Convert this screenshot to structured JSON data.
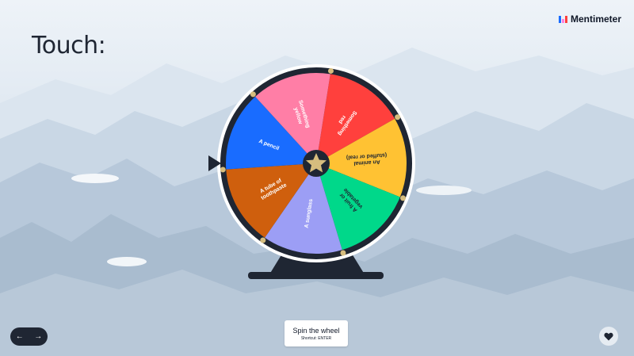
{
  "slide": {
    "title": "Touch:"
  },
  "brand": {
    "name": "Mentimeter",
    "logo_colors": [
      "#196cff",
      "#ff80e3",
      "#ff403d"
    ]
  },
  "wheel": {
    "center_icon": "star-icon",
    "pointer_icon": "triangle-pointer-icon",
    "segments": [
      {
        "label_lines": [
          "Something",
          "red"
        ],
        "color": "#ff403d"
      },
      {
        "label_lines": [
          "An animal",
          "(stuffed or real)"
        ],
        "color": "#ffc233"
      },
      {
        "label_lines": [
          "A fruit or",
          "vegetable"
        ],
        "color": "#00d88a"
      },
      {
        "label_lines": [
          "A sunglass"
        ],
        "color": "#9c9ef5"
      },
      {
        "label_lines": [
          "A tube of",
          "toothpaste"
        ],
        "color": "#cf5f0d"
      },
      {
        "label_lines": [
          "A pencil"
        ],
        "color": "#196cff"
      },
      {
        "label_lines": [
          "Something",
          "yellow"
        ],
        "color": "#ff7ea6"
      }
    ]
  },
  "spin": {
    "label": "Spin the wheel",
    "shortcut": "Shortcut: ENTER"
  },
  "nav": {
    "prev_icon": "arrow-left-icon",
    "next_icon": "arrow-right-icon"
  },
  "reaction": {
    "icon": "heart-icon"
  }
}
